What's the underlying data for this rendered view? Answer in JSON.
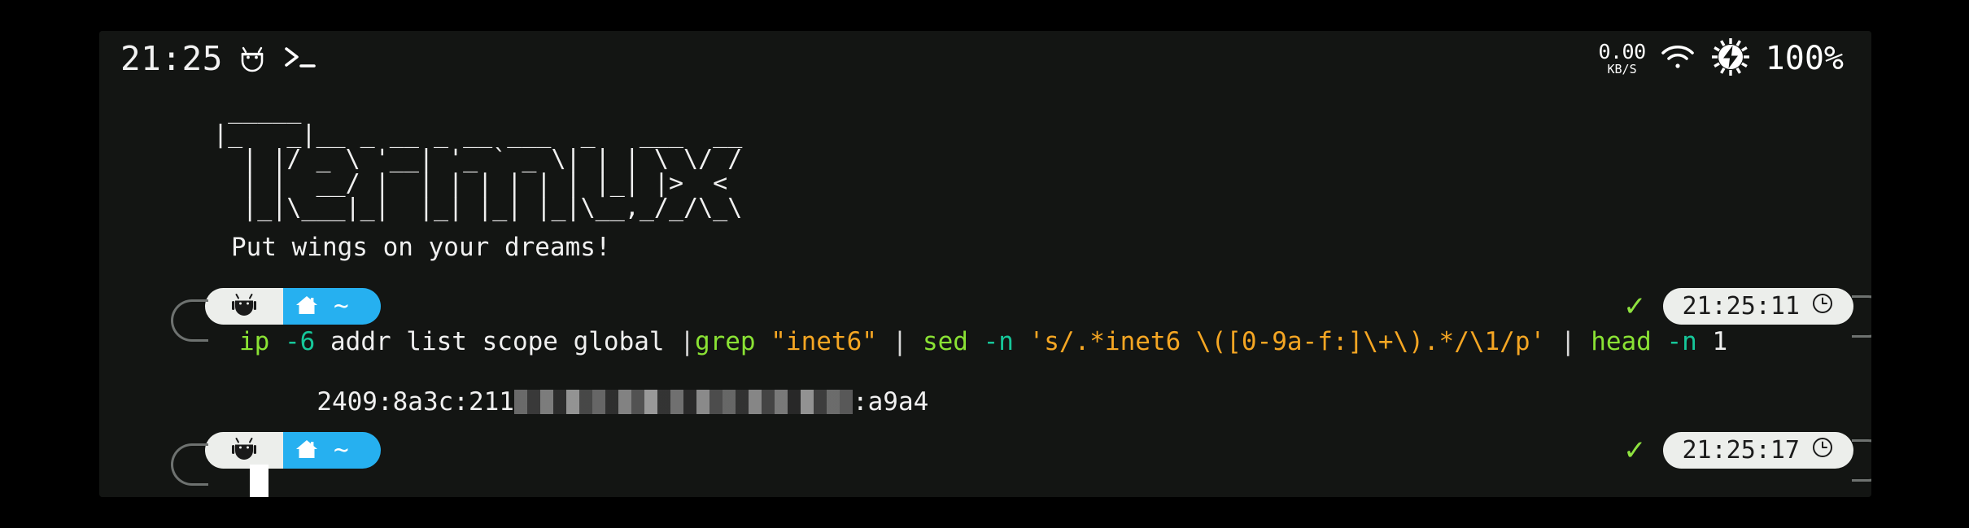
{
  "status_bar": {
    "clock": "21:25",
    "android_icon": "android-robot-icon",
    "shell_glyph": ">_",
    "net_speed_value": "0.00",
    "net_speed_unit": "KB/S",
    "wifi_icon": "wifi-icon",
    "battery_icon": "battery-charging-icon",
    "battery_percent": "100%"
  },
  "banner": {
    "ascii_art": "  _____\n |_   _|__ _ __ _ __ ___  _   ___  __\n   | |/ _ \\ '__| '_ ` _ \\| | | \\ \\/ /\n   | |  __/ |  | | | | | | |_| |>  <\n   |_|\\___|_|  |_| |_| |_|\\__,_/_/\\_\\",
    "tagline": "Put wings on your dreams!"
  },
  "prompts": [
    {
      "user_icon": "android-robot-icon",
      "home_icon": "home-icon",
      "path": "~",
      "exit_status_icon": "check-mark-icon",
      "timestamp": "21:25:11",
      "clock_icon": "clock-icon"
    },
    {
      "user_icon": "android-robot-icon",
      "home_icon": "home-icon",
      "path": "~",
      "exit_status_icon": "check-mark-icon",
      "timestamp": "21:25:17",
      "clock_icon": "clock-icon"
    }
  ],
  "command_line": {
    "full_text": "ip -6 addr list scope global |grep \"inet6\" | sed -n 's/.*inet6 \\([0-9a-f:]\\+\\).*/\\1/p' | head -n 1",
    "tokens": [
      {
        "text": "ip",
        "type": "cmd"
      },
      {
        "text": " ",
        "type": "plain"
      },
      {
        "text": "-6",
        "type": "flag"
      },
      {
        "text": " addr list scope global ",
        "type": "plain"
      },
      {
        "text": "|",
        "type": "pipe"
      },
      {
        "text": "grep",
        "type": "cmd"
      },
      {
        "text": " ",
        "type": "plain"
      },
      {
        "text": "\"inet6\"",
        "type": "str"
      },
      {
        "text": " ",
        "type": "plain"
      },
      {
        "text": "|",
        "type": "pipe"
      },
      {
        "text": " ",
        "type": "plain"
      },
      {
        "text": "sed",
        "type": "cmd"
      },
      {
        "text": " ",
        "type": "plain"
      },
      {
        "text": "-n",
        "type": "flag"
      },
      {
        "text": " ",
        "type": "plain"
      },
      {
        "text": "'s/.*inet6 \\([0-9a-f:]\\+\\).*/\\1/p'",
        "type": "str"
      },
      {
        "text": " ",
        "type": "plain"
      },
      {
        "text": "|",
        "type": "pipe"
      },
      {
        "text": " ",
        "type": "plain"
      },
      {
        "text": "head",
        "type": "cmd"
      },
      {
        "text": " ",
        "type": "plain"
      },
      {
        "text": "-n",
        "type": "flag"
      },
      {
        "text": " 1",
        "type": "plain"
      }
    ]
  },
  "output_line": {
    "prefix": "2409:8a3c:211",
    "redacted": true,
    "suffix": ":a9a4"
  },
  "colors": {
    "terminal_bg": "#131513",
    "frame_bg": "#000000",
    "text": "#f0f0f0",
    "prompt_user_bg": "#eceeeb",
    "prompt_path_bg": "#26b0f0",
    "badge_bg": "#eceeeb",
    "success_green": "#8ee23f",
    "token_cmd": "#8ae234",
    "token_flag": "#16c79a",
    "token_string": "#f5a623"
  }
}
